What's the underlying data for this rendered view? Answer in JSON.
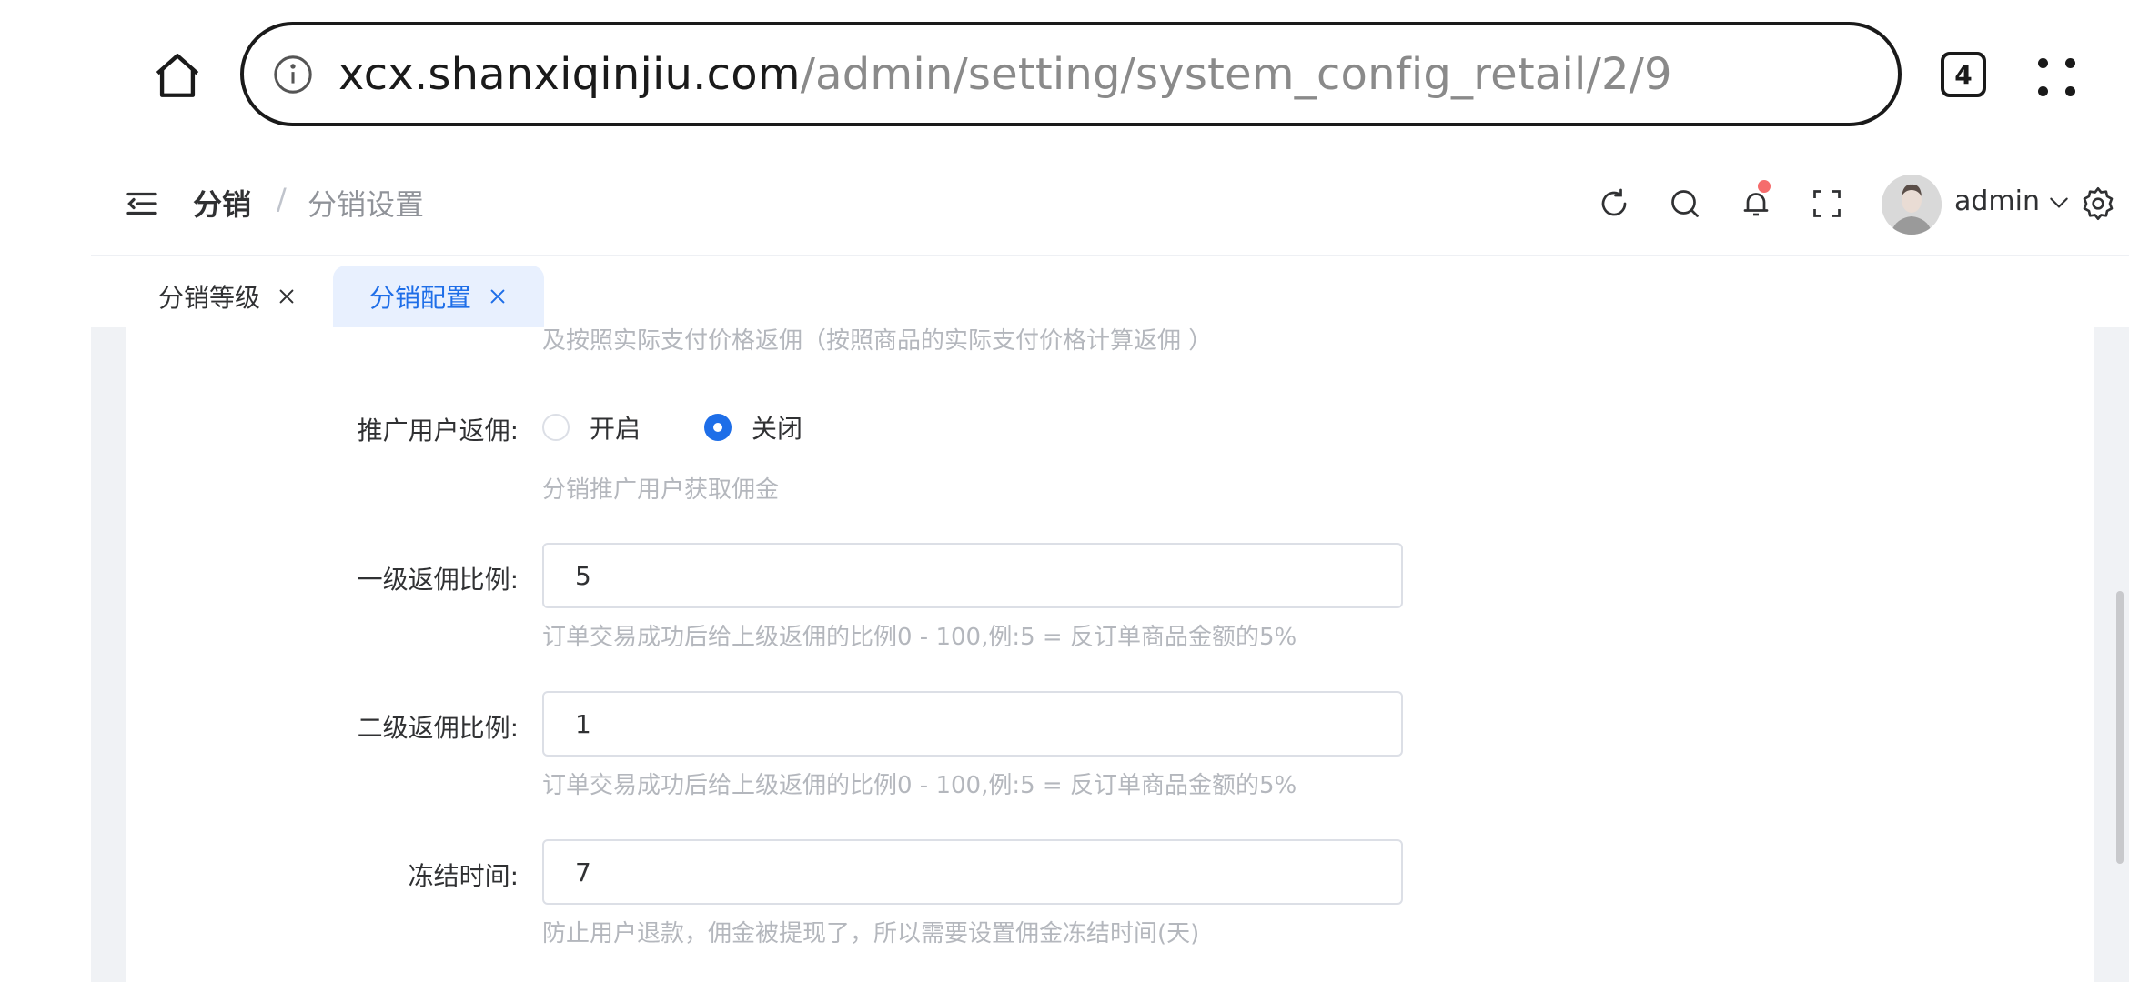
{
  "browser": {
    "url_host": "xcx.shanxiqinjiu.com",
    "url_path": "/admin/setting/system_config_retail/2/9",
    "tab_count": "4"
  },
  "header": {
    "breadcrumb_main": "分销",
    "breadcrumb_sep": "/",
    "breadcrumb_sub": "分销设置",
    "user_name": "admin"
  },
  "tabs": [
    {
      "label": "分销等级"
    },
    {
      "label": "分销配置"
    }
  ],
  "form": {
    "top_hint": "及按照实际支付价格返佣（按照商品的实际支付价格计算返佣 ）",
    "promote_rebate": {
      "label": "推广用户返佣:",
      "options": [
        "开启",
        "关闭"
      ],
      "selected": "关闭",
      "hint": "分销推广用户获取佣金"
    },
    "level1_ratio": {
      "label": "一级返佣比例:",
      "value": "5",
      "hint": "订单交易成功后给上级返佣的比例0 - 100,例:5 = 反订单商品金额的5%"
    },
    "level2_ratio": {
      "label": "二级返佣比例:",
      "value": "1",
      "hint": "订单交易成功后给上级返佣的比例0 - 100,例:5 = 反订单商品金额的5%"
    },
    "freeze_time": {
      "label": "冻结时间:",
      "value": "7",
      "hint": "防止用户退款，佣金被提现了，所以需要设置佣金冻结时间(天)"
    }
  },
  "icons": [
    "home-icon",
    "info-icon",
    "menu-dots-icon",
    "collapse-icon",
    "refresh-icon",
    "search-icon",
    "bell-icon",
    "fullscreen-icon",
    "avatar",
    "chevron-down-icon",
    "gear-icon",
    "close-icon"
  ],
  "colors": {
    "primary": "#1e6ee8",
    "notice_dot": "#f56c6c",
    "hint": "#b4b7bd",
    "content_bg": "#f0f2f5"
  }
}
